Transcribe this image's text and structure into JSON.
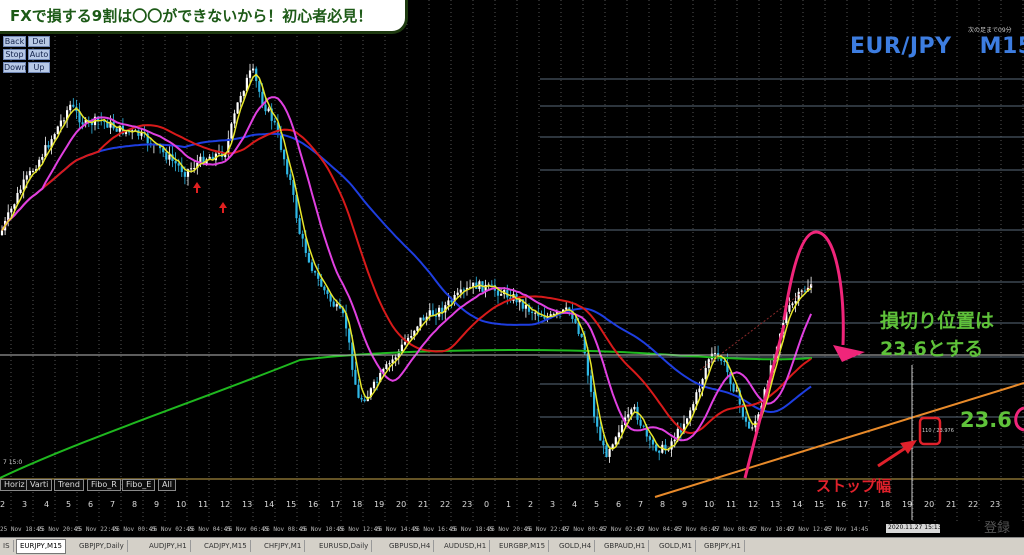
{
  "banner": {
    "text": "FXで損する9割は〇〇ができないから！初心者必見！"
  },
  "controls": [
    {
      "name": "back-button",
      "label": "Back"
    },
    {
      "name": "del-button",
      "label": "Del"
    },
    {
      "name": "stop-button",
      "label": "Stop"
    },
    {
      "name": "auto-button",
      "label": "Auto"
    },
    {
      "name": "down-button",
      "label": "Down"
    },
    {
      "name": "up-button",
      "label": "Up"
    }
  ],
  "chart_title": {
    "symbol": "EUR/JPY",
    "timeframe": "M15"
  },
  "top_right_small": "次の足まで09分",
  "annotation": {
    "line1": "損切り位置は",
    "line2": "23.6とする",
    "level_label": "23.6",
    "stop_label": "ストップ幅"
  },
  "left_small": "7 15:0",
  "measure_small": "110 / 23.976",
  "toolbar": [
    "Horiz",
    "Varti",
    "Trend",
    "Fibo_R",
    "Fibo_E",
    "All"
  ],
  "x_axis_labels": [
    "25 Nov 18:45",
    "25 Nov 20:45",
    "25 Nov 22:45",
    "26 Nov 00:45",
    "26 Nov 02:45",
    "26 Nov 04:45",
    "26 Nov 06:45",
    "26 Nov 08:45",
    "26 Nov 10:45",
    "26 Nov 12:45",
    "26 Nov 14:45",
    "26 Nov 16:45",
    "26 Nov 18:45",
    "26 Nov 20:45",
    "26 Nov 22:45",
    "27 Nov 00:45",
    "27 Nov 02:45",
    "27 Nov 04:45",
    "27 Nov 06:45",
    "27 Nov 08:45",
    "27 Nov 10:45",
    "27 Nov 12:45",
    "27 Nov 14:45"
  ],
  "hour_labels": [
    "2",
    "3",
    "4",
    "5",
    "6",
    "7",
    "8",
    "9",
    "10",
    "11",
    "12",
    "13",
    "14",
    "15",
    "16",
    "17",
    "18",
    "19",
    "20",
    "21",
    "22",
    "23",
    "0",
    "1",
    "2",
    "3",
    "4",
    "5",
    "6",
    "7",
    "8",
    "9",
    "10",
    "11",
    "12",
    "13",
    "14",
    "15",
    "16",
    "17",
    "18",
    "19",
    "20",
    "21",
    "22",
    "23"
  ],
  "time_box": "2020.11.27 15:13",
  "tabs": [
    "IS",
    "EURJPY,M15",
    "GBPJPY,Daily",
    "AUDJPY,H1",
    "CADJPY,M15",
    "CHFJPY,M1",
    "EURUSD,Daily",
    "GBPUSD,H4",
    "AUDUSD,H1",
    "EURGBP,M15",
    "GOLD,H4",
    "GBPAUD,H1",
    "GOLD,M1",
    "GBPJPY,H1"
  ],
  "watermark": "登録",
  "colors": {
    "background": "#000000",
    "candle": "#ffffff",
    "candle_up": "#2fb8e6",
    "ma_yellow": "#e6e62a",
    "ma_magenta": "#e040e0",
    "ma_red": "#d81a1a",
    "ma_blue": "#1e3ee0",
    "ma_green": "#1fb81f",
    "trend_orange": "#e88a2a",
    "highlight_pink": "#f0257a",
    "annotation_green": "#5fc23a"
  }
}
